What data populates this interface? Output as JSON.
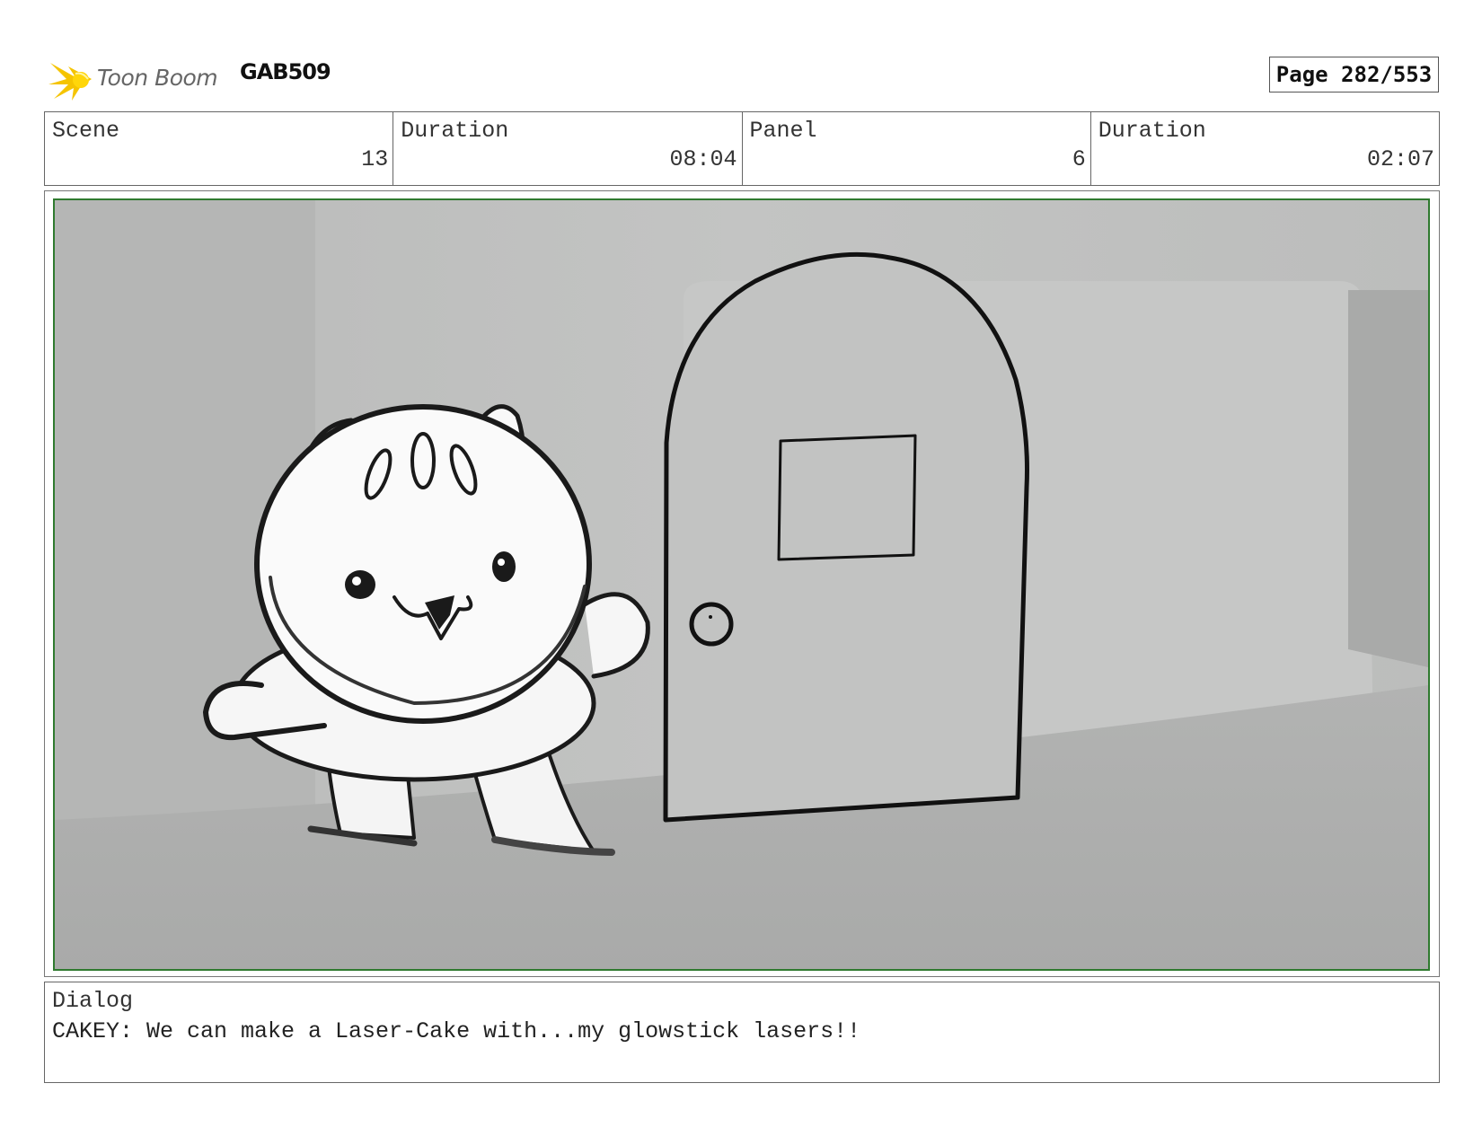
{
  "header": {
    "logo_text": "Toon Boom",
    "project_code": "GAB509",
    "page_label": "Page 282/553"
  },
  "info": {
    "scene_label": "Scene",
    "scene_value": "13",
    "scene_duration_label": "Duration",
    "scene_duration_value": "08:04",
    "panel_label": "Panel",
    "panel_value": "6",
    "panel_duration_label": "Duration",
    "panel_duration_value": "02:07"
  },
  "dialog": {
    "label": "Dialog",
    "text": "CAKEY: We can make a Laser-Cake with...my glowstick lasers!!"
  },
  "icons": {
    "logo": "toon-boom-star-icon"
  },
  "colors": {
    "panel_border": "#2f7a2f",
    "logo_star": "#f5c400"
  }
}
